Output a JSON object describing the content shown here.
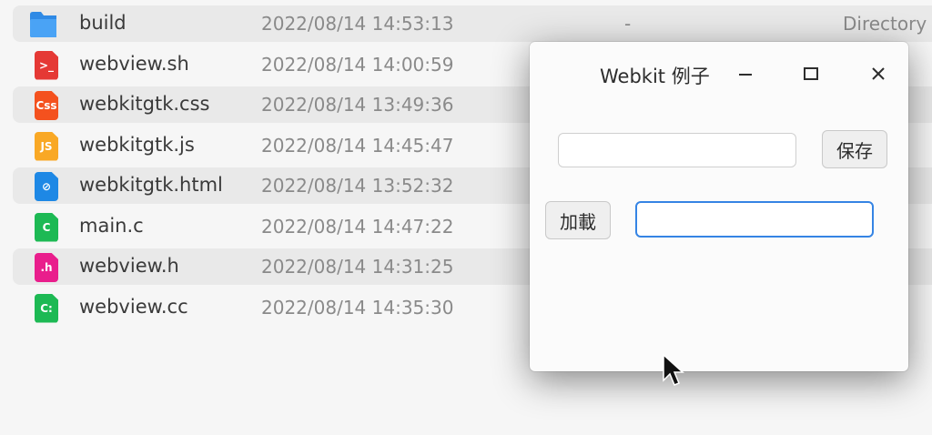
{
  "files": [
    {
      "name": "build",
      "date": "2022/08/14 14:53:13",
      "size": "-",
      "kind": "Directory",
      "icon": "folder-icon",
      "icon_color": "#2f8ae5",
      "icon_text": ""
    },
    {
      "name": "webview.sh",
      "date": "2022/08/14 14:00:59",
      "size": "",
      "kind": "",
      "icon": "shell-script-icon",
      "icon_color": "#e53935",
      "icon_text": ">_"
    },
    {
      "name": "webkitgtk.css",
      "date": "2022/08/14 13:49:36",
      "size": "",
      "kind": "",
      "icon": "css-file-icon",
      "icon_color": "#f4511e",
      "icon_text": "Css"
    },
    {
      "name": "webkitgtk.js",
      "date": "2022/08/14 14:45:47",
      "size": "",
      "kind": "",
      "icon": "js-file-icon",
      "icon_color": "#f9a825",
      "icon_text": "JS"
    },
    {
      "name": "webkitgtk.html",
      "date": "2022/08/14 13:52:32",
      "size": "",
      "kind": "",
      "icon": "html-file-icon",
      "icon_color": "#1e88e5",
      "icon_text": "⊘"
    },
    {
      "name": "main.c",
      "date": "2022/08/14 14:47:22",
      "size": "",
      "kind": "",
      "icon": "c-file-icon",
      "icon_color": "#1db954",
      "icon_text": "C"
    },
    {
      "name": "webview.h",
      "date": "2022/08/14 14:31:25",
      "size": "",
      "kind": "",
      "icon": "header-file-icon",
      "icon_color": "#e91e8c",
      "icon_text": ".h"
    },
    {
      "name": "webview.cc",
      "date": "2022/08/14 14:35:30",
      "size": "",
      "kind": "",
      "icon": "cpp-file-icon",
      "icon_color": "#1db954",
      "icon_text": "C:"
    }
  ],
  "dialog": {
    "title": "Webkit 例子",
    "save_label": "保存",
    "load_label": "加載",
    "save_input_value": "",
    "load_input_value": ""
  }
}
